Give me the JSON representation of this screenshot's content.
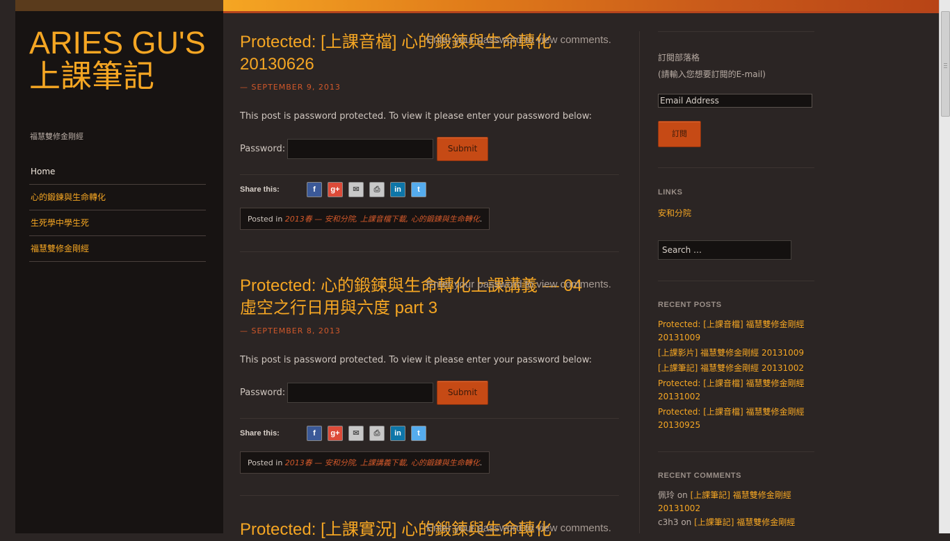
{
  "site": {
    "title": "ARIES GU'S 上課筆記",
    "description": "福慧雙修金剛經"
  },
  "nav": {
    "items": [
      {
        "label": "Home"
      },
      {
        "label": "心的鍛鍊與生命轉化"
      },
      {
        "label": "生死學中學生死"
      },
      {
        "label": "福慧雙修金剛經"
      }
    ]
  },
  "posts": [
    {
      "title": "Protected: [上課音檔] 心的鍛鍊與生命轉化 20130626",
      "comments_link": "Enter your password to view comments.",
      "date": "— SEPTEMBER 9, 2013",
      "protected_msg": "This post is password protected. To view it please enter your password below:",
      "password_label": "Password:",
      "submit_label": "Submit",
      "share_label": "Share this:",
      "posted_in_label": "Posted in",
      "categories": "2013春 — 安和分院, 上課音檔下載, 心的鍛鍊與生命轉化",
      "categories_end": "."
    },
    {
      "title": "Protected: 心的鍛鍊與生命轉化上課講義 — 04 虛空之行日用與六度 part 3",
      "comments_link": "Enter your password to view comments.",
      "date": "— SEPTEMBER 8, 2013",
      "protected_msg": "This post is password protected. To view it please enter your password below:",
      "password_label": "Password:",
      "submit_label": "Submit",
      "share_label": "Share this:",
      "posted_in_label": "Posted in",
      "categories": "2013春 — 安和分院, 上課講義下載, 心的鍛鍊與生命轉化",
      "categories_end": "."
    },
    {
      "title": "Protected: [上課實況] 心的鍛鍊與生命轉化",
      "comments_link": "Enter your password to view comments."
    }
  ],
  "share_icons": [
    "facebook-icon",
    "google-plus-icon",
    "email-icon",
    "print-icon",
    "linkedin-icon",
    "twitter-icon"
  ],
  "subscribe": {
    "title": "訂閱部落格",
    "instruction": "(請輸入您想要訂閱的E-mail)",
    "email_placeholder": "Email Address",
    "button_label": "訂閱"
  },
  "links": {
    "title": "LINKS",
    "items": [
      {
        "label": "安和分院"
      }
    ]
  },
  "search": {
    "placeholder": "Search …"
  },
  "recent_posts": {
    "title": "RECENT POSTS",
    "items": [
      {
        "label": "Protected: [上課音檔] 福慧雙修金剛經 20131009"
      },
      {
        "label": "[上課影片] 福慧雙修金剛經 20131009"
      },
      {
        "label": "[上課筆記] 福慧雙修金剛經 20131002"
      },
      {
        "label": "Protected: [上課音檔] 福慧雙修金剛經 20131002"
      },
      {
        "label": "Protected: [上課音檔] 福慧雙修金剛經 20130925"
      }
    ]
  },
  "recent_comments": {
    "title": "RECENT COMMENTS",
    "items": [
      {
        "author": "佩玲",
        "on": "on",
        "post": "[上課筆記] 福慧雙修金剛經 20131002"
      },
      {
        "author": "c3h3",
        "on": "on",
        "post": "[上課筆記] 福慧雙修金剛經"
      }
    ]
  },
  "colors": {
    "accent": "#f5a623",
    "link_red": "#d1582a",
    "button": "#c64a15",
    "background": "#2b2524",
    "sidebar": "#171312"
  }
}
